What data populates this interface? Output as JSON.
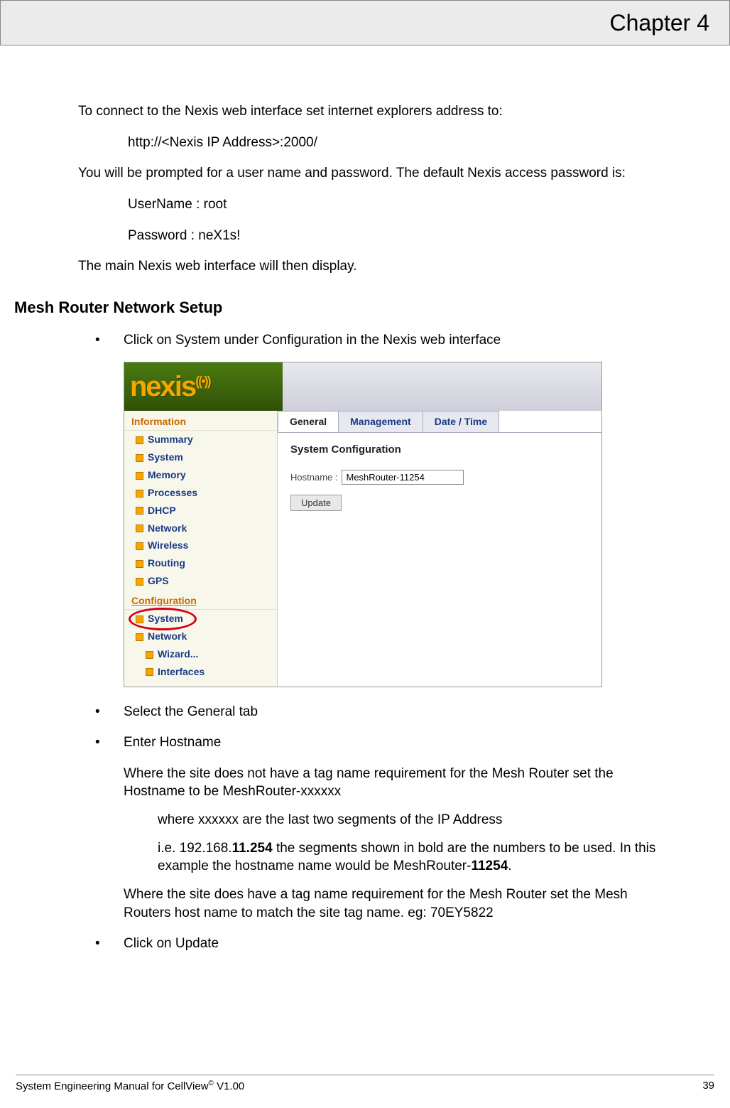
{
  "header": {
    "chapter": "Chapter 4"
  },
  "body": {
    "p1": "To connect to the Nexis web interface set internet explorers address to:",
    "url": "http://<Nexis IP Address>:2000/",
    "p2": "You will be prompted for a user name and password. The default Nexis access password is:",
    "cred_user": "UserName : root",
    "cred_pass": "Password : neX1s!",
    "p3": "The main Nexis web interface will then display.",
    "h2": "Mesh Router Network Setup",
    "b1": "Click on System under Configuration in the Nexis web interface",
    "b2": "Select the General tab",
    "b3": "Enter Hostname",
    "b3_p1": "Where the site does not have a tag name requirement for the Mesh Router set the Hostname to be MeshRouter-xxxxxx",
    "b3_i1": "where xxxxxx are the last two segments of the IP Address",
    "b3_i2a": "i.e. 192.168.",
    "b3_i2b": "11.254",
    "b3_i2c": " the segments shown in bold are the numbers to be used. In this example the hostname name would be MeshRouter-",
    "b3_i2d": "11254",
    "b3_i2e": ".",
    "b3_p2": "Where the site does have a tag name requirement for the Mesh Router set the Mesh Routers host name to match the site tag name. eg: 70EY5822",
    "b4": "Click on Update"
  },
  "screenshot": {
    "logo": "nexis",
    "sidebar": {
      "section_info": "Information",
      "items_info": [
        "Summary",
        "System",
        "Memory",
        "Processes",
        "DHCP",
        "Network",
        "Wireless",
        "Routing",
        "GPS"
      ],
      "section_config": "Configuration",
      "item_system": "System",
      "item_network": "Network",
      "sub_wizard": "Wizard...",
      "sub_interfaces": "Interfaces"
    },
    "tabs": {
      "general": "General",
      "management": "Management",
      "datetime": "Date / Time"
    },
    "panel_title": "System Configuration",
    "hostname_label": "Hostname :",
    "hostname_value": "MeshRouter-11254",
    "update_btn": "Update"
  },
  "footer": {
    "left_a": "System Engineering Manual for CellView",
    "left_b": " V1.00",
    "page": "39"
  }
}
